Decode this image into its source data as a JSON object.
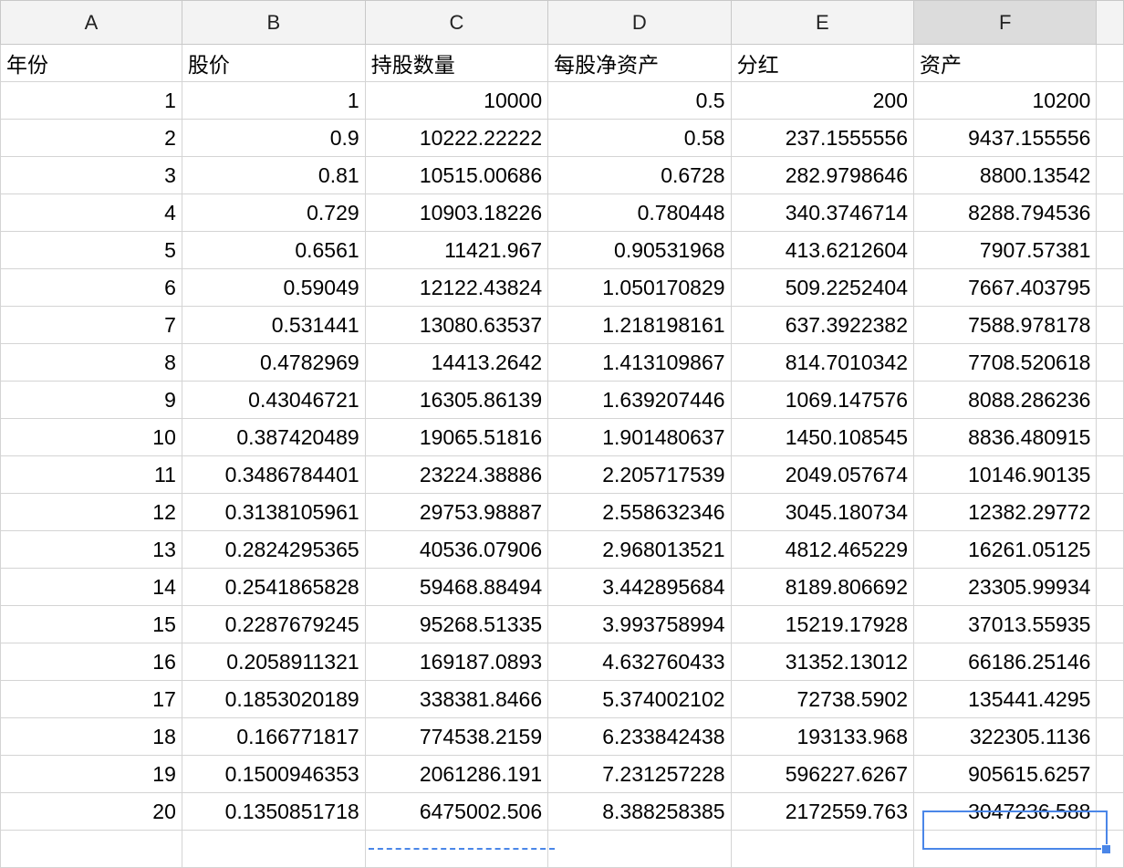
{
  "columns": [
    "A",
    "B",
    "C",
    "D",
    "E",
    "F"
  ],
  "selected_column": "F",
  "header_row": [
    "年份",
    "股价",
    "持股数量",
    "每股净资产",
    "分红",
    "资产"
  ],
  "rows": [
    [
      "1",
      "1",
      "10000",
      "0.5",
      "200",
      "10200"
    ],
    [
      "2",
      "0.9",
      "10222.22222",
      "0.58",
      "237.1555556",
      "9437.155556"
    ],
    [
      "3",
      "0.81",
      "10515.00686",
      "0.6728",
      "282.9798646",
      "8800.13542"
    ],
    [
      "4",
      "0.729",
      "10903.18226",
      "0.780448",
      "340.3746714",
      "8288.794536"
    ],
    [
      "5",
      "0.6561",
      "11421.967",
      "0.90531968",
      "413.6212604",
      "7907.57381"
    ],
    [
      "6",
      "0.59049",
      "12122.43824",
      "1.050170829",
      "509.2252404",
      "7667.403795"
    ],
    [
      "7",
      "0.531441",
      "13080.63537",
      "1.218198161",
      "637.3922382",
      "7588.978178"
    ],
    [
      "8",
      "0.4782969",
      "14413.2642",
      "1.413109867",
      "814.7010342",
      "7708.520618"
    ],
    [
      "9",
      "0.43046721",
      "16305.86139",
      "1.639207446",
      "1069.147576",
      "8088.286236"
    ],
    [
      "10",
      "0.387420489",
      "19065.51816",
      "1.901480637",
      "1450.108545",
      "8836.480915"
    ],
    [
      "11",
      "0.3486784401",
      "23224.38886",
      "2.205717539",
      "2049.057674",
      "10146.90135"
    ],
    [
      "12",
      "0.3138105961",
      "29753.98887",
      "2.558632346",
      "3045.180734",
      "12382.29772"
    ],
    [
      "13",
      "0.2824295365",
      "40536.07906",
      "2.968013521",
      "4812.465229",
      "16261.05125"
    ],
    [
      "14",
      "0.2541865828",
      "59468.88494",
      "3.442895684",
      "8189.806692",
      "23305.99934"
    ],
    [
      "15",
      "0.2287679245",
      "95268.51335",
      "3.993758994",
      "15219.17928",
      "37013.55935"
    ],
    [
      "16",
      "0.2058911321",
      "169187.0893",
      "4.632760433",
      "31352.13012",
      "66186.25146"
    ],
    [
      "17",
      "0.1853020189",
      "338381.8466",
      "5.374002102",
      "72738.5902",
      "135441.4295"
    ],
    [
      "18",
      "0.166771817",
      "774538.2159",
      "6.233842438",
      "193133.968",
      "322305.1136"
    ],
    [
      "19",
      "0.1500946353",
      "2061286.191",
      "7.231257228",
      "596227.6267",
      "905615.6257"
    ],
    [
      "20",
      "0.1350851718",
      "6475002.506",
      "8.388258385",
      "2172559.763",
      "3047236.588"
    ]
  ],
  "accent_color": "#4a86e8"
}
